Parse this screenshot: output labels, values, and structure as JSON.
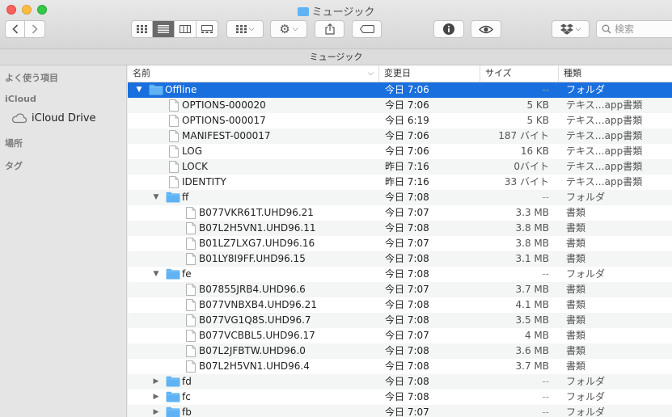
{
  "window": {
    "title": "ミュージック",
    "path_title": "ミュージック"
  },
  "toolbar": {
    "back_icon": "chevron-left-icon",
    "forward_icon": "chevron-right-icon",
    "search_placeholder": "検索"
  },
  "sidebar": {
    "favorites": "よく使う項目",
    "icloud": "iCloud",
    "icloud_drive": "iCloud Drive",
    "places": "場所",
    "tags": "タグ"
  },
  "columns": {
    "name": "名前",
    "date": "変更日",
    "size": "サイズ",
    "kind": "種類"
  },
  "colors": {
    "selection": "#1a6fde",
    "folder": "#5fb3f5"
  },
  "rows": [
    {
      "name": "Offline",
      "date": "今日 7:06",
      "size": "--",
      "kind": "フォルダ",
      "type": "folder",
      "level": 0,
      "expanded": true,
      "selected": true
    },
    {
      "name": "OPTIONS-000020",
      "date": "今日 7:06",
      "size": "5 KB",
      "kind": "テキス…app書類",
      "type": "file",
      "level": 1
    },
    {
      "name": "OPTIONS-000017",
      "date": "今日 6:19",
      "size": "5 KB",
      "kind": "テキス…app書類",
      "type": "file",
      "level": 1
    },
    {
      "name": "MANIFEST-000017",
      "date": "今日 7:06",
      "size": "187 バイト",
      "kind": "テキス…app書類",
      "type": "file",
      "level": 1
    },
    {
      "name": "LOG",
      "date": "今日 7:06",
      "size": "16 KB",
      "kind": "テキス…app書類",
      "type": "file",
      "level": 1
    },
    {
      "name": "LOCK",
      "date": "昨日 7:16",
      "size": "0バイト",
      "kind": "テキス…app書類",
      "type": "file",
      "level": 1
    },
    {
      "name": "IDENTITY",
      "date": "昨日 7:16",
      "size": "33 バイト",
      "kind": "テキス…app書類",
      "type": "file",
      "level": 1
    },
    {
      "name": "ff",
      "date": "今日 7:08",
      "size": "--",
      "kind": "フォルダ",
      "type": "folder",
      "level": 1,
      "expanded": true
    },
    {
      "name": "B077VKR61T.UHD96.21",
      "date": "今日 7:07",
      "size": "3.3 MB",
      "kind": "書類",
      "type": "file",
      "level": 2
    },
    {
      "name": "B07L2H5VN1.UHD96.11",
      "date": "今日 7:08",
      "size": "3.8 MB",
      "kind": "書類",
      "type": "file",
      "level": 2
    },
    {
      "name": "B01LZ7LXG7.UHD96.16",
      "date": "今日 7:07",
      "size": "3.8 MB",
      "kind": "書類",
      "type": "file",
      "level": 2
    },
    {
      "name": "B01LY8I9FF.UHD96.15",
      "date": "今日 7:08",
      "size": "3.1 MB",
      "kind": "書類",
      "type": "file",
      "level": 2
    },
    {
      "name": "fe",
      "date": "今日 7:08",
      "size": "--",
      "kind": "フォルダ",
      "type": "folder",
      "level": 1,
      "expanded": true
    },
    {
      "name": "B07855JRB4.UHD96.6",
      "date": "今日 7:07",
      "size": "3.7 MB",
      "kind": "書類",
      "type": "file",
      "level": 2
    },
    {
      "name": "B077VNBXB4.UHD96.21",
      "date": "今日 7:08",
      "size": "4.1 MB",
      "kind": "書類",
      "type": "file",
      "level": 2
    },
    {
      "name": "B077VG1Q8S.UHD96.7",
      "date": "今日 7:08",
      "size": "3.5 MB",
      "kind": "書類",
      "type": "file",
      "level": 2
    },
    {
      "name": "B077VCBBL5.UHD96.17",
      "date": "今日 7:07",
      "size": "4 MB",
      "kind": "書類",
      "type": "file",
      "level": 2
    },
    {
      "name": "B07L2JFBTW.UHD96.0",
      "date": "今日 7:08",
      "size": "3.6 MB",
      "kind": "書類",
      "type": "file",
      "level": 2
    },
    {
      "name": "B07L2H5VN1.UHD96.4",
      "date": "今日 7:08",
      "size": "3.7 MB",
      "kind": "書類",
      "type": "file",
      "level": 2
    },
    {
      "name": "fd",
      "date": "今日 7:08",
      "size": "--",
      "kind": "フォルダ",
      "type": "folder",
      "level": 1,
      "expanded": false
    },
    {
      "name": "fc",
      "date": "今日 7:08",
      "size": "--",
      "kind": "フォルダ",
      "type": "folder",
      "level": 1,
      "expanded": false
    },
    {
      "name": "fb",
      "date": "今日 7:07",
      "size": "--",
      "kind": "フォルダ",
      "type": "folder",
      "level": 1,
      "expanded": false
    }
  ]
}
